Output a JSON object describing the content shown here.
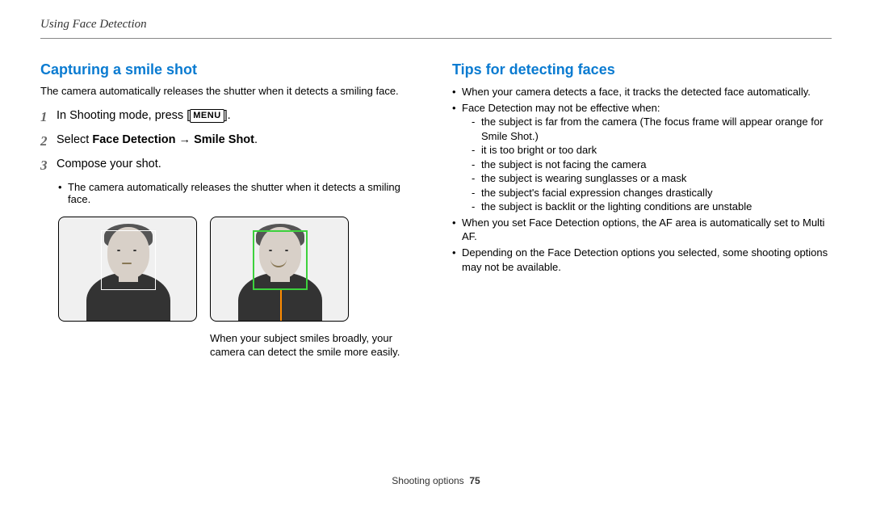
{
  "header": "Using Face Detection",
  "left": {
    "title": "Capturing a smile shot",
    "intro": "The camera automatically releases the shutter when it detects a smiling face.",
    "steps": {
      "n1": "1",
      "s1_a": "In Shooting mode, press [",
      "s1_menu": "MENU",
      "s1_b": "].",
      "n2": "2",
      "s2_a": "Select ",
      "s2_b": "Face Detection",
      "s2_arrow": " → ",
      "s2_c": "Smile Shot",
      "s2_d": ".",
      "n3": "3",
      "s3": "Compose your shot."
    },
    "sub": "The camera automatically releases the shutter when it detects a smiling face.",
    "caption": "When your subject smiles broadly, your camera can detect the smile more easily."
  },
  "right": {
    "title": "Tips for detecting faces",
    "b1": "When your camera detects a face, it tracks the detected face automatically.",
    "b2": "Face Detection may not be effective when:",
    "sub1": "the subject is far from the camera (The focus frame will appear orange for Smile Shot.)",
    "sub2": "it is too bright or too dark",
    "sub3": "the subject is not facing the camera",
    "sub4": "the subject is wearing sunglasses or a mask",
    "sub5": "the subject's facial expression changes drastically",
    "sub6": "the subject is backlit or the lighting conditions are unstable",
    "b3": "When you set Face Detection options, the AF area is automatically set to Multi AF.",
    "b4": "Depending on the Face Detection options you selected, some shooting options may not be available."
  },
  "footer": {
    "section": "Shooting options",
    "page": "75"
  }
}
